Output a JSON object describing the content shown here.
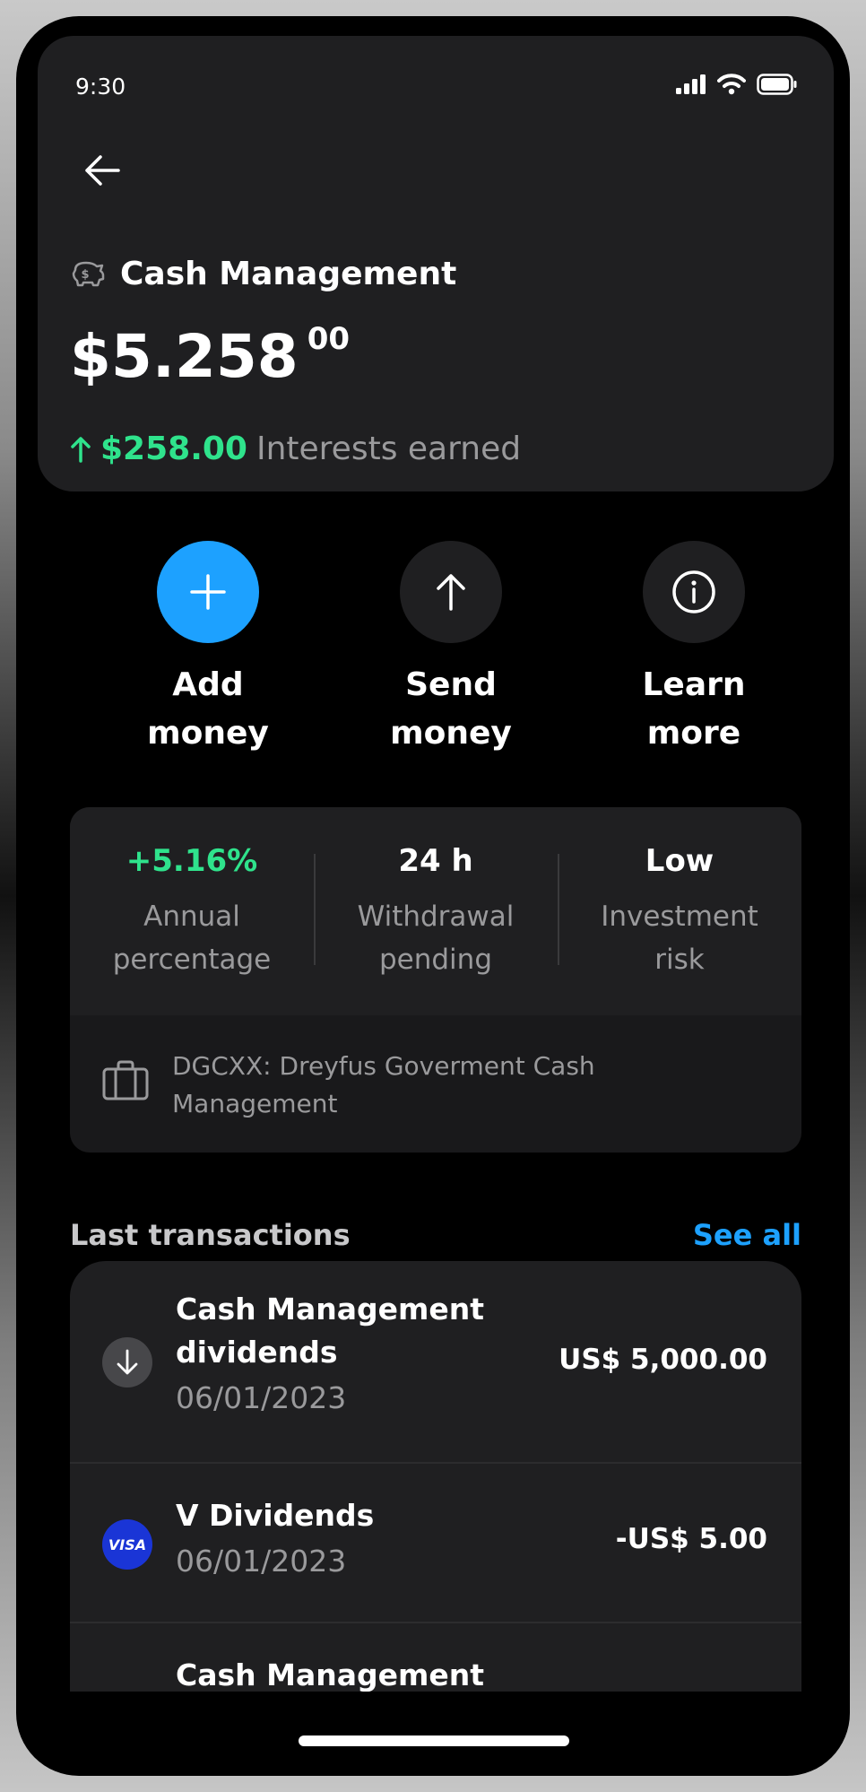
{
  "status_bar": {
    "time": "9:30"
  },
  "header": {
    "title": "Cash Management",
    "balance_main": "$5.258",
    "balance_cents": "00",
    "interest_amount": "$258.00",
    "interest_label": "Interests earned"
  },
  "actions": [
    {
      "label": "Add money",
      "icon": "plus-icon"
    },
    {
      "label": "Send money",
      "icon": "arrow-up-icon"
    },
    {
      "label": "Learn more",
      "icon": "info-icon"
    }
  ],
  "stats": [
    {
      "value": "+5.16%",
      "label": "Annual percentage"
    },
    {
      "value": "24 h",
      "label": "Withdrawal pending"
    },
    {
      "value": "Low",
      "label": "Investment risk"
    }
  ],
  "fund": {
    "text": "DGCXX: Dreyfus Goverment Cash Management",
    "icon": "briefcase-icon"
  },
  "transactions_section": {
    "title": "Last transactions",
    "see_all": "See all"
  },
  "transactions": [
    {
      "name": "Cash Management dividends",
      "date": "06/01/2023",
      "amount": "US$ 5,000.00",
      "icon": "arrow-down-icon"
    },
    {
      "name": "V Dividends",
      "date": "06/01/2023",
      "amount": "-US$ 5.00",
      "icon": "visa-logo",
      "logo_text": "VISA"
    },
    {
      "name": "Cash Management",
      "date": "",
      "amount": "",
      "icon": ""
    }
  ],
  "colors": {
    "accent": "#1da1ff",
    "positive": "#2fe38c",
    "card": "#1f1f21",
    "visa": "#1a35d6"
  }
}
